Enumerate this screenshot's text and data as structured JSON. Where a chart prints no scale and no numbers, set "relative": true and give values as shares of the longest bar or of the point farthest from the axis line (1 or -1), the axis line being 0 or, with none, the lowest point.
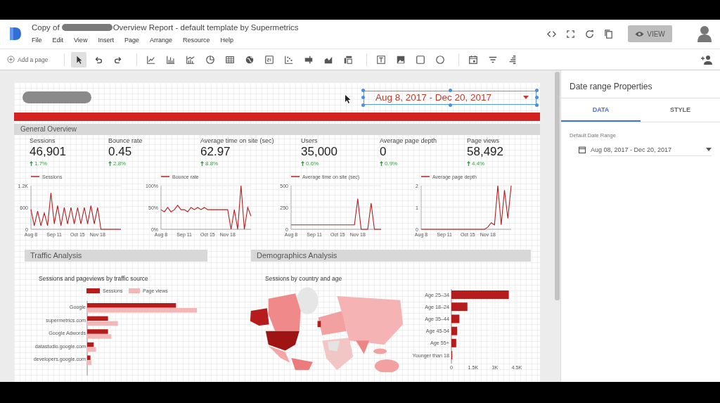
{
  "window": {
    "title_start": "Copy of",
    "title_end": "Overview Report - default template by Supermetrics"
  },
  "menu": [
    "File",
    "Edit",
    "View",
    "Insert",
    "Page",
    "Arrange",
    "Resource",
    "Help"
  ],
  "view_button": "VIEW",
  "toolbar": {
    "add_page": "Add a page",
    "tool_groups": [
      [
        {
          "kind": "pointer",
          "selected": true
        },
        {
          "kind": "undo",
          "selected": false
        },
        {
          "kind": "redo",
          "selected": false
        }
      ],
      [
        {
          "kind": "line-chart",
          "selected": false
        },
        {
          "kind": "bar-chart",
          "selected": false
        },
        {
          "kind": "combo-chart",
          "selected": false
        },
        {
          "kind": "pie-chart",
          "selected": false
        },
        {
          "kind": "table",
          "selected": false
        },
        {
          "kind": "globe",
          "selected": false
        },
        {
          "kind": "scorecard",
          "selected": false
        },
        {
          "kind": "scatter-chart",
          "selected": false
        },
        {
          "kind": "bullet-chart",
          "selected": false
        },
        {
          "kind": "area-chart",
          "selected": false
        },
        {
          "kind": "pivot-table",
          "selected": false
        }
      ],
      [
        {
          "kind": "text",
          "selected": false
        },
        {
          "kind": "image",
          "selected": false
        },
        {
          "kind": "rectangle",
          "selected": false
        },
        {
          "kind": "circle",
          "selected": false
        }
      ],
      [
        {
          "kind": "calendar",
          "selected": false
        },
        {
          "kind": "filter",
          "selected": false
        },
        {
          "kind": "data-control",
          "selected": false
        }
      ]
    ]
  },
  "date_control": {
    "text": "Aug 8, 2017 - Dec 20, 2017",
    "selected": true
  },
  "overview": {
    "title": "General Overview",
    "scorecards": [
      {
        "label": "Sessions",
        "value": "46,901",
        "change": "1.7%"
      },
      {
        "label": "Bounce rate",
        "value": "0.45",
        "change": "2.8%"
      },
      {
        "label": "Average time on site (sec)",
        "value": "62.97",
        "change": "8.8%"
      },
      {
        "label": "Users",
        "value": "35,000",
        "change": "0.6%"
      },
      {
        "label": "Average page depth",
        "value": "0",
        "change": "0.9%"
      },
      {
        "label": "Page views",
        "value": "58,492",
        "change": "4.4%"
      }
    ]
  },
  "trend_charts": [
    {
      "chart_data": {
        "type": "line",
        "categories": [
          "Aug 8",
          null,
          null,
          null,
          null,
          null,
          null,
          "Sep 11",
          null,
          null,
          null,
          null,
          null,
          null,
          "Oct 15",
          null,
          null,
          null,
          null,
          null,
          "Nov 18",
          null,
          null,
          null,
          null,
          null,
          null,
          null
        ],
        "ylim": [
          0,
          1200
        ],
        "yticks": [
          {
            "value": 0,
            "label": "0"
          },
          {
            "value": 600,
            "label": "600"
          },
          {
            "value": 1200,
            "label": "1.2K"
          }
        ],
        "series": [
          {
            "name": "Sessions",
            "color": "#b71c1c",
            "values": [
              550,
              100,
              500,
              100,
              450,
              100,
              1000,
              150,
              650,
              100,
              600,
              150,
              600,
              150,
              600,
              150,
              600,
              150,
              650,
              150,
              600,
              0,
              0,
              0,
              0,
              0,
              0,
              0
            ]
          }
        ]
      }
    },
    {
      "chart_data": {
        "type": "line",
        "categories": [
          "Aug 8",
          null,
          null,
          null,
          null,
          null,
          null,
          "Sep 11",
          null,
          null,
          null,
          null,
          null,
          null,
          "Oct 15",
          null,
          null,
          null,
          null,
          null,
          "Nov 18",
          null,
          null,
          null,
          null,
          null,
          null,
          null
        ],
        "ylim": [
          0,
          100
        ],
        "yticks": [
          {
            "value": 0,
            "label": "0%"
          },
          {
            "value": 50,
            "label": "50%"
          },
          {
            "value": 100,
            "label": "100%"
          }
        ],
        "series": [
          {
            "name": "Bounce rate",
            "color": "#b71c1c",
            "values": [
              45,
              40,
              50,
              40,
              45,
              55,
              45,
              45,
              40,
              50,
              45,
              50,
              45,
              50,
              45,
              45,
              45,
              45,
              45,
              45,
              45,
              0,
              45,
              0,
              100,
              0,
              50,
              30
            ]
          }
        ]
      }
    },
    {
      "chart_data": {
        "type": "line",
        "categories": [
          "Aug 8",
          null,
          null,
          null,
          null,
          null,
          null,
          "Sep 11",
          null,
          null,
          null,
          null,
          null,
          null,
          "Oct 15",
          null,
          null,
          null,
          null,
          null,
          "Nov 18",
          null,
          null,
          null,
          null,
          null,
          null,
          null
        ],
        "ylim": [
          0,
          500
        ],
        "yticks": [
          {
            "value": 0,
            "label": "0"
          },
          {
            "value": 250,
            "label": "250"
          },
          {
            "value": 500,
            "label": "500"
          }
        ],
        "series": [
          {
            "name": "Average time on site (sec)",
            "color": "#b71c1c",
            "values": [
              50,
              50,
              50,
              50,
              50,
              50,
              50,
              50,
              50,
              50,
              50,
              50,
              50,
              50,
              50,
              50,
              50,
              50,
              50,
              50,
              350,
              0,
              0,
              0,
              300,
              0,
              0,
              0
            ]
          }
        ]
      }
    },
    {
      "chart_data": {
        "type": "line",
        "categories": [
          "Aug 8",
          null,
          null,
          null,
          null,
          null,
          null,
          "Sep 11",
          null,
          null,
          null,
          null,
          null,
          null,
          "Oct 15",
          null,
          null,
          null,
          null,
          null,
          "Nov 18",
          null,
          null,
          null,
          null,
          null,
          null,
          null
        ],
        "ylim": [
          0,
          2
        ],
        "yticks": [
          {
            "value": 0,
            "label": "0"
          },
          {
            "value": 1,
            "label": "1"
          },
          {
            "value": 2,
            "label": "2"
          }
        ],
        "series": [
          {
            "name": "Average page depth",
            "color": "#b71c1c",
            "values": [
              0,
              0,
              0,
              0,
              0,
              0,
              0,
              0,
              0,
              0,
              0,
              0,
              0,
              0,
              0,
              0,
              0,
              0,
              0,
              0,
              0.1,
              0.3,
              0.2,
              2,
              0.2,
              1.8,
              0.5,
              2
            ]
          }
        ]
      }
    }
  ],
  "traffic": {
    "title": "Traffic Analysis",
    "chart_data": {
      "type": "bar",
      "orientation": "horizontal",
      "relative": true,
      "legend": "top",
      "title": "Sessions and pageviews by traffic source",
      "categories": [
        "Google",
        "supermetrics.com",
        "Google Adwords",
        "datastudio.google.com",
        "developers.google.com"
      ],
      "series": [
        {
          "name": "Sessions",
          "color": "#b71c1c",
          "values": [
            0.81,
            0.19,
            0.19,
            0.06,
            0.03
          ]
        },
        {
          "name": "Page views",
          "color": "#f4b7b7",
          "values": [
            1,
            0.28,
            0.22,
            0.08,
            0.04
          ]
        }
      ]
    }
  },
  "demographics": {
    "title": "Demographics Analysis",
    "chart_title": "Sessions by country and age",
    "chart_data": {
      "type": "bar",
      "orientation": "horizontal",
      "categories": [
        "Age 25–34",
        "Age 18–24",
        "Age 35–44",
        "Age 45-54",
        "Age 55+",
        "Younger than 18"
      ],
      "values": [
        3950,
        1100,
        550,
        400,
        330,
        60
      ],
      "xlim": [
        0,
        4500
      ],
      "xticks": [
        {
          "value": 0,
          "label": "0"
        },
        {
          "value": 1500,
          "label": "1.5K"
        },
        {
          "value": 3000,
          "label": "3K"
        },
        {
          "value": 4500,
          "label": "4.5K"
        }
      ]
    }
  },
  "panel": {
    "title": "Date range Properties",
    "tabs": [
      {
        "label": "DATA",
        "selected": true
      },
      {
        "label": "STYLE",
        "selected": false
      }
    ],
    "field_label": "Default Date Range",
    "field_value": "Aug 08, 2017 - Dec 20, 2017"
  }
}
